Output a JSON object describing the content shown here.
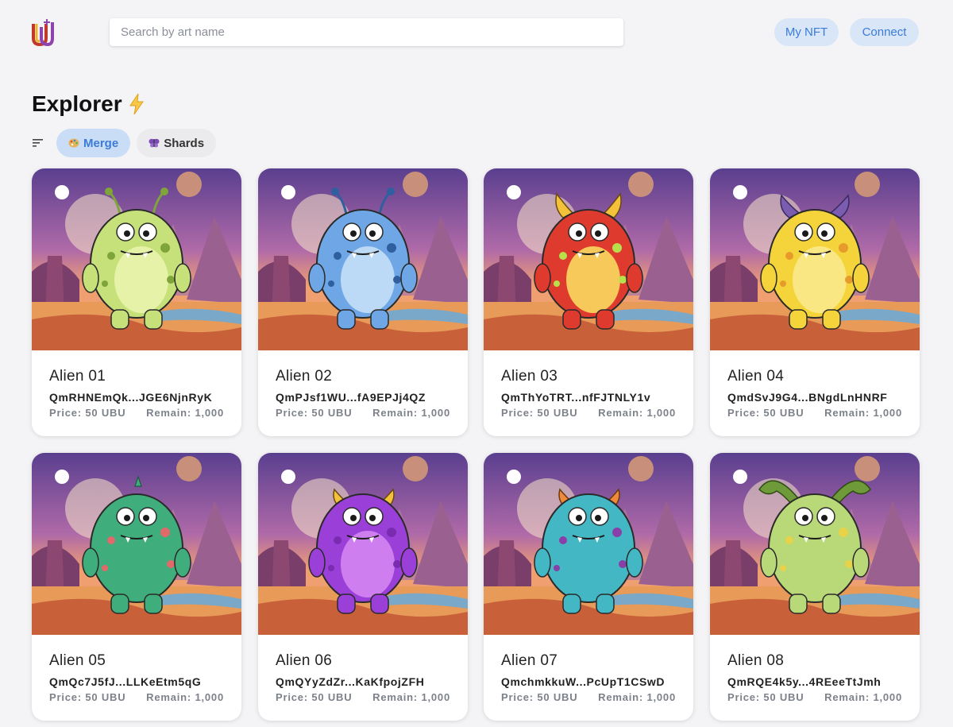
{
  "header": {
    "search_placeholder": "Search by art name",
    "my_nft_label": "My NFT",
    "connect_label": "Connect"
  },
  "page": {
    "title": "Explorer"
  },
  "filters": {
    "merge_label": "Merge",
    "shards_label": "Shards",
    "active": "Merge"
  },
  "colors": {
    "accent": "#3b7bd6",
    "accent_bg": "#d9e6f7",
    "page_bg": "#f4f4f6"
  },
  "cards": [
    {
      "name": "Alien 01",
      "hash": "QmRHNEmQk...JGE6NjnRyK",
      "price": "Price: 50 UBU",
      "remain": "Remain: 1,000",
      "body": "#c6e07a",
      "belly": "#e6f2a8",
      "spots": "#7fa53a",
      "horns": "antennae"
    },
    {
      "name": "Alien 02",
      "hash": "QmPJsf1WU...fA9EPJj4QZ",
      "price": "Price: 50 UBU",
      "remain": "Remain: 1,000",
      "body": "#6fa6e6",
      "belly": "#bcd9f5",
      "spots": "#2f5f9e",
      "horns": "antennae"
    },
    {
      "name": "Alien 03",
      "hash": "QmThYoTRT...nfFJTNLY1v",
      "price": "Price: 50 UBU",
      "remain": "Remain: 1,000",
      "body": "#df3a2e",
      "belly": "#f7c95a",
      "spots": "#b7e04a",
      "horns": "horns-yellow"
    },
    {
      "name": "Alien 04",
      "hash": "QmdSvJ9G4...BNgdLnHNRF",
      "price": "Price: 50 UBU",
      "remain": "Remain: 1,000",
      "body": "#f4d43a",
      "belly": "#f9e783",
      "spots": "#e69b2a",
      "horns": "horns-purple"
    },
    {
      "name": "Alien 05",
      "hash": "QmQc7J5fJ...LLKeEtm5qG",
      "price": "Price: 50 UBU",
      "remain": "Remain: 1,000",
      "body": "#3fae7c",
      "belly": "#3fae7c",
      "spots": "#e06a6a",
      "horns": "spikes"
    },
    {
      "name": "Alien 06",
      "hash": "QmQYyZdZr...KaKfpojZFH",
      "price": "Price: 50 UBU",
      "remain": "Remain: 1,000",
      "body": "#9b3fd9",
      "belly": "#cf7ef0",
      "spots": "#7a2bb0",
      "horns": "horns-yellow-small"
    },
    {
      "name": "Alien 07",
      "hash": "QmchmkkuW...PcUpT1CSwD",
      "price": "Price: 50 UBU",
      "remain": "Remain: 1,000",
      "body": "#44b7c4",
      "belly": "#44b7c4",
      "spots": "#8a3ea8",
      "horns": "horns-rainbow"
    },
    {
      "name": "Alien 08",
      "hash": "QmRQE4k5y...4REeeTtJmh",
      "price": "Price: 50 UBU",
      "remain": "Remain: 1,000",
      "body": "#b9d978",
      "belly": "#b9d978",
      "spots": "#e8d24a",
      "horns": "ram"
    }
  ]
}
